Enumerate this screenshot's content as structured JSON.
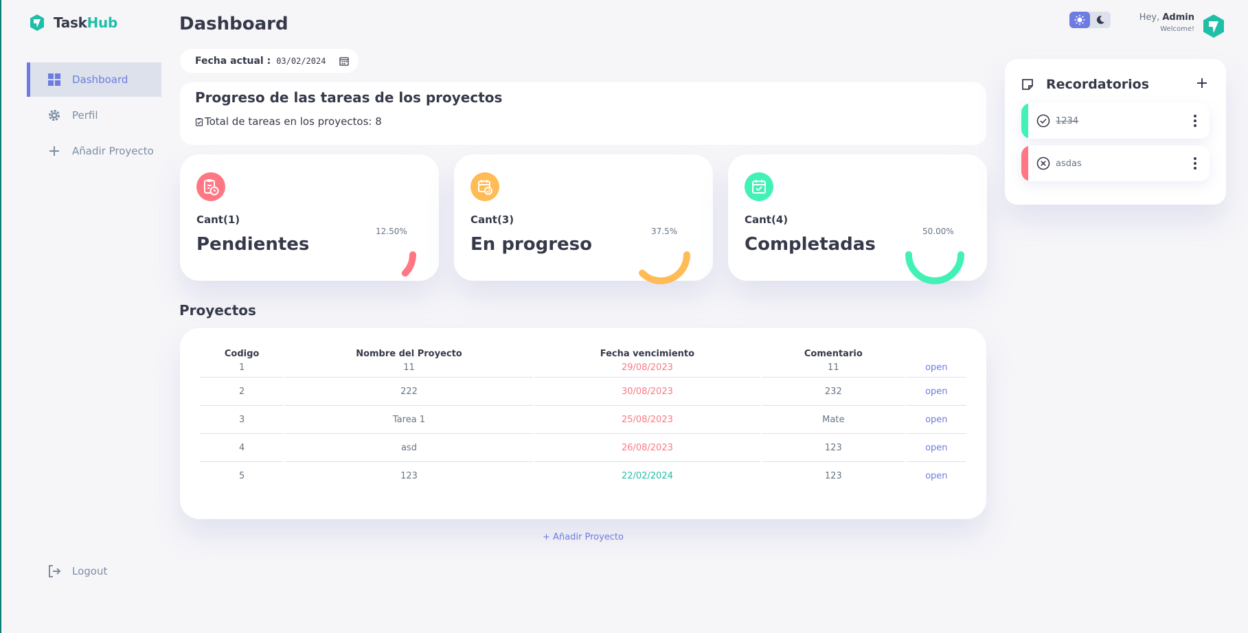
{
  "app": {
    "name_part1": "Task",
    "name_part2": "Hub"
  },
  "sidebar": {
    "items": [
      {
        "label": "Dashboard",
        "icon": "grid-icon",
        "active": true
      },
      {
        "label": "Perfil",
        "icon": "gear-icon",
        "active": false
      },
      {
        "label": "Añadir Proyecto",
        "icon": "plus-icon",
        "active": false
      }
    ],
    "logout_label": "Logout"
  },
  "header": {
    "title": "Dashboard",
    "date_label": "Fecha actual :",
    "date_value": "03/02/2024"
  },
  "progress": {
    "title": "Progreso de las tareas de los proyectos",
    "total_label": "Total de tareas en los proyectos: 8"
  },
  "stats": [
    {
      "count": "Cant(1)",
      "name": "Pendientes",
      "percent_label": "12.50%",
      "percent": 12.5,
      "color": "#ff7782",
      "icon": "clipboard-clock-icon"
    },
    {
      "count": "Cant(3)",
      "name": "En progreso",
      "percent_label": "37.5%",
      "percent": 37.5,
      "color": "#ffbb55",
      "icon": "calendar-refresh-icon"
    },
    {
      "count": "Cant(4)",
      "name": "Completadas",
      "percent_label": "50.00%",
      "percent": 50.0,
      "color": "#41f1b6",
      "icon": "calendar-check-icon"
    }
  ],
  "projects": {
    "title": "Proyectos",
    "columns": [
      "Codigo",
      "Nombre del Proyecto",
      "Fecha vencimiento",
      "Comentario",
      ""
    ],
    "rows": [
      {
        "code": "1",
        "name": "11",
        "due": "29/08/2023",
        "due_status": "overdue",
        "comment": "11",
        "action": "open"
      },
      {
        "code": "2",
        "name": "222",
        "due": "30/08/2023",
        "due_status": "overdue",
        "comment": "232",
        "action": "open"
      },
      {
        "code": "3",
        "name": "Tarea 1",
        "due": "25/08/2023",
        "due_status": "overdue",
        "comment": "Mate",
        "action": "open"
      },
      {
        "code": "4",
        "name": "asd",
        "due": "26/08/2023",
        "due_status": "overdue",
        "comment": "123",
        "action": "open"
      },
      {
        "code": "5",
        "name": "123",
        "due": "22/02/2024",
        "due_status": "ok",
        "comment": "123",
        "action": "open"
      }
    ],
    "add_label": "+ Añadir Proyecto"
  },
  "user": {
    "greeting": "Hey,",
    "name": "Admin",
    "subtitle": "Welcome!"
  },
  "reminders": {
    "title": "Recordatorios",
    "items": [
      {
        "text": "1234",
        "done": true,
        "color": "#41f1b6",
        "icon": "check-circle-icon"
      },
      {
        "text": "asdas",
        "done": false,
        "color": "#ff7782",
        "icon": "x-circle-icon"
      }
    ]
  },
  "colors": {
    "primary": "#6c7ce0",
    "danger": "#ff7782",
    "warning": "#ffbb55",
    "success": "#41f1b6",
    "brand": "#1fbfa7"
  }
}
